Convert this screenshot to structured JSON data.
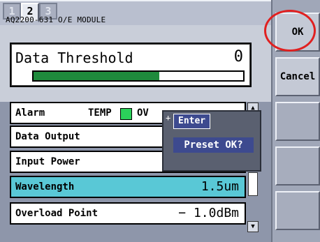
{
  "tabs": [
    {
      "label": "1",
      "active": false
    },
    {
      "label": "2",
      "active": true
    },
    {
      "label": "3",
      "active": false
    }
  ],
  "module_name": "AQ2200-631 O/E MODULE",
  "threshold": {
    "label": "Data Threshold",
    "value": "0",
    "bar_level": 0.6
  },
  "rows": [
    {
      "label": "Alarm",
      "temp": "TEMP",
      "ovl": "OV"
    },
    {
      "label": "Data Output",
      "value": ""
    },
    {
      "label": "Input Power",
      "value": ""
    },
    {
      "label": "Wavelength",
      "value": "1.5um"
    },
    {
      "label": "Overload Point",
      "value": "−   1.0dBm"
    }
  ],
  "popup": {
    "title": "Enter",
    "message": "Preset OK?"
  },
  "buttons": {
    "ok": "OK",
    "cancel": "Cancel"
  },
  "colors": {
    "highlight": "#59c8d6",
    "temp_indicator": "#2bd15a",
    "bar_fill": "#1f8a3c",
    "circle": "#e02020"
  }
}
